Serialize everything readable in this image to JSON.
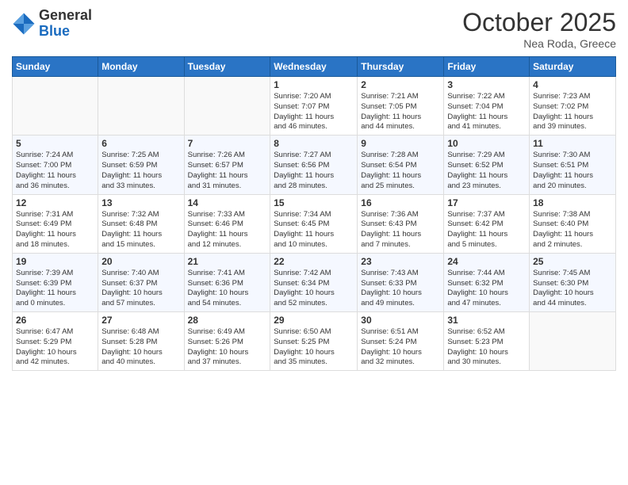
{
  "header": {
    "logo_general": "General",
    "logo_blue": "Blue",
    "month_title": "October 2025",
    "subtitle": "Nea Roda, Greece"
  },
  "days_of_week": [
    "Sunday",
    "Monday",
    "Tuesday",
    "Wednesday",
    "Thursday",
    "Friday",
    "Saturday"
  ],
  "weeks": [
    [
      {
        "day": "",
        "info": ""
      },
      {
        "day": "",
        "info": ""
      },
      {
        "day": "",
        "info": ""
      },
      {
        "day": "1",
        "info": "Sunrise: 7:20 AM\nSunset: 7:07 PM\nDaylight: 11 hours\nand 46 minutes."
      },
      {
        "day": "2",
        "info": "Sunrise: 7:21 AM\nSunset: 7:05 PM\nDaylight: 11 hours\nand 44 minutes."
      },
      {
        "day": "3",
        "info": "Sunrise: 7:22 AM\nSunset: 7:04 PM\nDaylight: 11 hours\nand 41 minutes."
      },
      {
        "day": "4",
        "info": "Sunrise: 7:23 AM\nSunset: 7:02 PM\nDaylight: 11 hours\nand 39 minutes."
      }
    ],
    [
      {
        "day": "5",
        "info": "Sunrise: 7:24 AM\nSunset: 7:00 PM\nDaylight: 11 hours\nand 36 minutes."
      },
      {
        "day": "6",
        "info": "Sunrise: 7:25 AM\nSunset: 6:59 PM\nDaylight: 11 hours\nand 33 minutes."
      },
      {
        "day": "7",
        "info": "Sunrise: 7:26 AM\nSunset: 6:57 PM\nDaylight: 11 hours\nand 31 minutes."
      },
      {
        "day": "8",
        "info": "Sunrise: 7:27 AM\nSunset: 6:56 PM\nDaylight: 11 hours\nand 28 minutes."
      },
      {
        "day": "9",
        "info": "Sunrise: 7:28 AM\nSunset: 6:54 PM\nDaylight: 11 hours\nand 25 minutes."
      },
      {
        "day": "10",
        "info": "Sunrise: 7:29 AM\nSunset: 6:52 PM\nDaylight: 11 hours\nand 23 minutes."
      },
      {
        "day": "11",
        "info": "Sunrise: 7:30 AM\nSunset: 6:51 PM\nDaylight: 11 hours\nand 20 minutes."
      }
    ],
    [
      {
        "day": "12",
        "info": "Sunrise: 7:31 AM\nSunset: 6:49 PM\nDaylight: 11 hours\nand 18 minutes."
      },
      {
        "day": "13",
        "info": "Sunrise: 7:32 AM\nSunset: 6:48 PM\nDaylight: 11 hours\nand 15 minutes."
      },
      {
        "day": "14",
        "info": "Sunrise: 7:33 AM\nSunset: 6:46 PM\nDaylight: 11 hours\nand 12 minutes."
      },
      {
        "day": "15",
        "info": "Sunrise: 7:34 AM\nSunset: 6:45 PM\nDaylight: 11 hours\nand 10 minutes."
      },
      {
        "day": "16",
        "info": "Sunrise: 7:36 AM\nSunset: 6:43 PM\nDaylight: 11 hours\nand 7 minutes."
      },
      {
        "day": "17",
        "info": "Sunrise: 7:37 AM\nSunset: 6:42 PM\nDaylight: 11 hours\nand 5 minutes."
      },
      {
        "day": "18",
        "info": "Sunrise: 7:38 AM\nSunset: 6:40 PM\nDaylight: 11 hours\nand 2 minutes."
      }
    ],
    [
      {
        "day": "19",
        "info": "Sunrise: 7:39 AM\nSunset: 6:39 PM\nDaylight: 11 hours\nand 0 minutes."
      },
      {
        "day": "20",
        "info": "Sunrise: 7:40 AM\nSunset: 6:37 PM\nDaylight: 10 hours\nand 57 minutes."
      },
      {
        "day": "21",
        "info": "Sunrise: 7:41 AM\nSunset: 6:36 PM\nDaylight: 10 hours\nand 54 minutes."
      },
      {
        "day": "22",
        "info": "Sunrise: 7:42 AM\nSunset: 6:34 PM\nDaylight: 10 hours\nand 52 minutes."
      },
      {
        "day": "23",
        "info": "Sunrise: 7:43 AM\nSunset: 6:33 PM\nDaylight: 10 hours\nand 49 minutes."
      },
      {
        "day": "24",
        "info": "Sunrise: 7:44 AM\nSunset: 6:32 PM\nDaylight: 10 hours\nand 47 minutes."
      },
      {
        "day": "25",
        "info": "Sunrise: 7:45 AM\nSunset: 6:30 PM\nDaylight: 10 hours\nand 44 minutes."
      }
    ],
    [
      {
        "day": "26",
        "info": "Sunrise: 6:47 AM\nSunset: 5:29 PM\nDaylight: 10 hours\nand 42 minutes."
      },
      {
        "day": "27",
        "info": "Sunrise: 6:48 AM\nSunset: 5:28 PM\nDaylight: 10 hours\nand 40 minutes."
      },
      {
        "day": "28",
        "info": "Sunrise: 6:49 AM\nSunset: 5:26 PM\nDaylight: 10 hours\nand 37 minutes."
      },
      {
        "day": "29",
        "info": "Sunrise: 6:50 AM\nSunset: 5:25 PM\nDaylight: 10 hours\nand 35 minutes."
      },
      {
        "day": "30",
        "info": "Sunrise: 6:51 AM\nSunset: 5:24 PM\nDaylight: 10 hours\nand 32 minutes."
      },
      {
        "day": "31",
        "info": "Sunrise: 6:52 AM\nSunset: 5:23 PM\nDaylight: 10 hours\nand 30 minutes."
      },
      {
        "day": "",
        "info": ""
      }
    ]
  ]
}
